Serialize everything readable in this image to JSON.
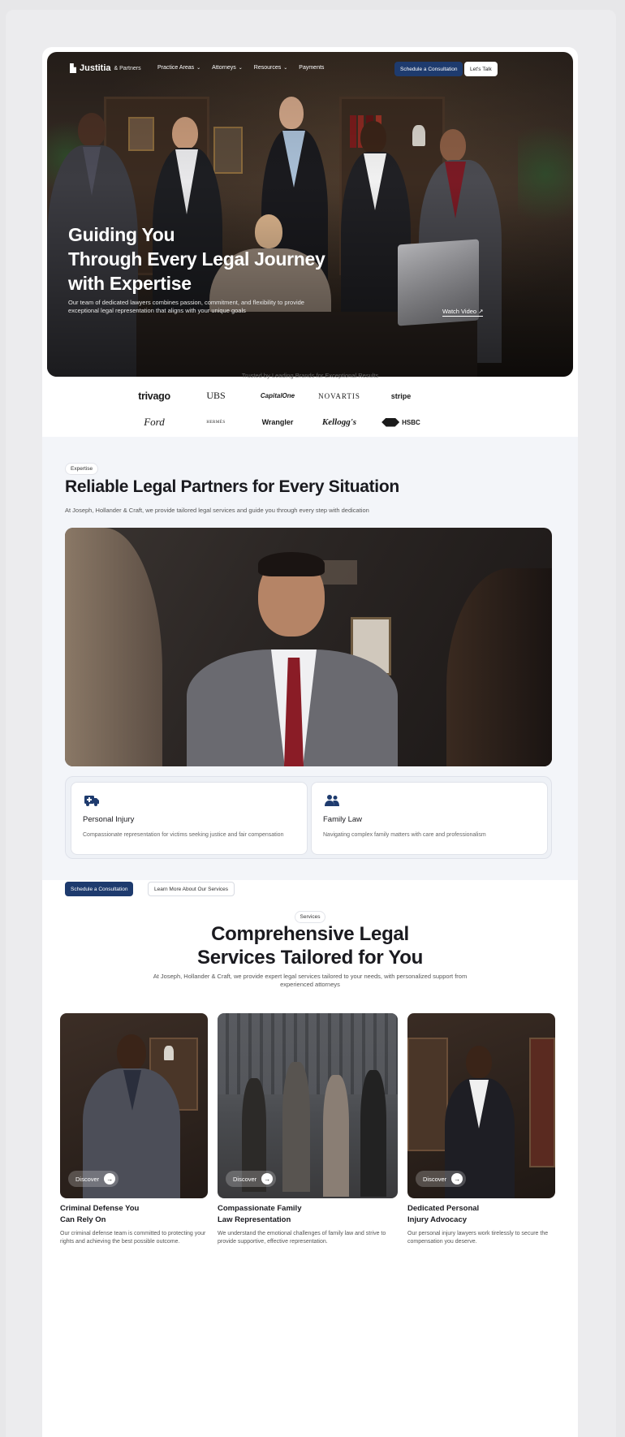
{
  "nav": {
    "brand": "Justitia",
    "brand_sub": "& Partners",
    "links": [
      "Practice Areas",
      "Attorneys",
      "Resources",
      "Payments"
    ],
    "consult_button": "Schedule a Consultation",
    "talk_button": "Let's Talk"
  },
  "hero": {
    "title_lines": [
      "Guiding You",
      "Through Every Legal Journey",
      "with Expertise"
    ],
    "description": "Our team of dedicated lawyers combines passion, commitment, and flexibility to provide exceptional legal representation that aligns with your unique goals",
    "watch_video": "Watch Video ↗"
  },
  "brands": {
    "heading": "Trusted by Leading Brands for Exceptional Results",
    "row1": [
      "trivago",
      "UBS",
      "CapitalOne",
      "NOVARTIS",
      "stripe"
    ],
    "row2": [
      "Ford",
      "HERMÈS",
      "Wrangler",
      "Kellogg's",
      "HSBC"
    ]
  },
  "expertise": {
    "pill": "Expertise",
    "title": "Reliable Legal Partners for Every Situation",
    "description": "At Joseph, Hollander & Craft, we provide tailored legal services and guide you through every step with dedication",
    "cards": [
      {
        "title": "Personal Injury",
        "description": "Compassionate representation for victims seeking justice and fair compensation",
        "icon": "ambulance-icon"
      },
      {
        "title": "Family Law",
        "description": "Navigating complex family matters with care and professionalism",
        "icon": "family-icon"
      }
    ],
    "primary_button": "Schedule a Consultation",
    "secondary_button": "Learn More About Our Services"
  },
  "services": {
    "pill": "Services",
    "title_lines": [
      "Comprehensive Legal",
      "Services Tailored for You"
    ],
    "description": "At Joseph, Hollander & Craft, we provide expert legal services tailored to your needs, with personalized support from experienced attorneys",
    "discover_label": "Discover",
    "cards": [
      {
        "title_lines": [
          "Criminal Defense You",
          "Can Rely On"
        ],
        "description": "Our criminal defense team is committed to protecting your rights and achieving the best possible outcome."
      },
      {
        "title_lines": [
          "Compassionate Family",
          "Law Representation"
        ],
        "description": "We understand the emotional challenges of family law and strive to provide supportive, effective representation."
      },
      {
        "title_lines": [
          "Dedicated Personal",
          "Injury Advocacy"
        ],
        "description": "Our personal injury lawyers work tirelessly to secure the compensation you deserve."
      }
    ]
  },
  "colors": {
    "accent": "#1e3b6e",
    "section_bg": "#f3f5f9"
  }
}
